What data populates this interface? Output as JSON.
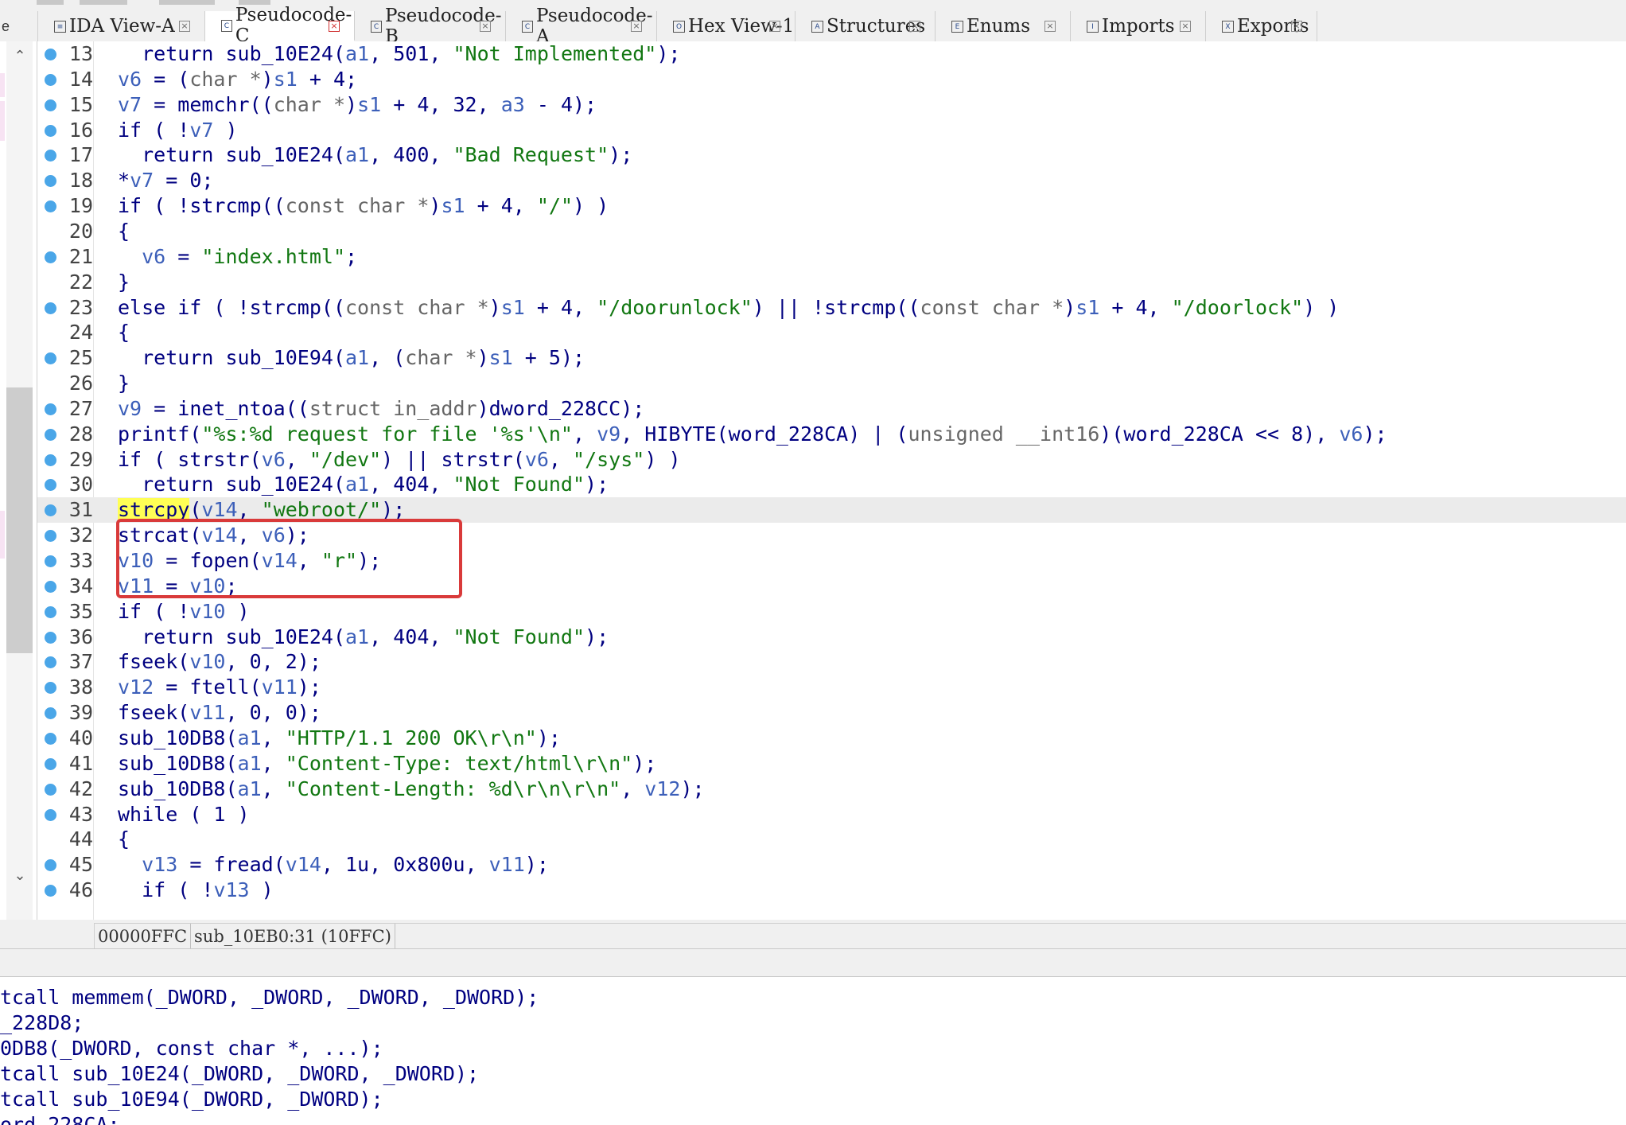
{
  "tabs": [
    {
      "label": "IDA View-A",
      "icon": "ida-view-icon",
      "active": false
    },
    {
      "label": "Pseudocode-C",
      "icon": "pseudocode-icon",
      "active": true
    },
    {
      "label": "Pseudocode-B",
      "icon": "pseudocode-icon",
      "active": false
    },
    {
      "label": "Pseudocode-A",
      "icon": "pseudocode-icon",
      "active": false
    },
    {
      "label": "Hex View-1",
      "icon": "hex-view-icon",
      "active": false
    },
    {
      "label": "Structures",
      "icon": "structures-icon",
      "active": false
    },
    {
      "label": "Enums",
      "icon": "enums-icon",
      "active": false
    },
    {
      "label": "Imports",
      "icon": "imports-icon",
      "active": false
    },
    {
      "label": "Exports",
      "icon": "exports-icon",
      "active": false
    }
  ],
  "tab_stub_label": "e",
  "highlighted_line": 31,
  "boxed_lines": [
    30,
    31,
    32
  ],
  "code_lines": [
    {
      "n": "13",
      "dot": true,
      "tokens": [
        [
          "p",
          "  "
        ],
        [
          "k",
          "return "
        ],
        [
          "g",
          "sub_10E24"
        ],
        [
          "p",
          "("
        ],
        [
          "v",
          "a1"
        ],
        [
          "p",
          ", "
        ],
        [
          "n",
          "501"
        ],
        [
          "p",
          ", "
        ],
        [
          "s",
          "\"Not Implemented\""
        ],
        [
          "p",
          ");"
        ]
      ]
    },
    {
      "n": "14",
      "dot": true,
      "tokens": [
        [
          "v",
          "v6"
        ],
        [
          "p",
          " = ("
        ],
        [
          "c",
          "char *"
        ],
        [
          "p",
          ")"
        ],
        [
          "v",
          "s1"
        ],
        [
          "p",
          " + 4;"
        ]
      ]
    },
    {
      "n": "15",
      "dot": true,
      "tokens": [
        [
          "v",
          "v7"
        ],
        [
          "p",
          " = "
        ],
        [
          "g",
          "memchr"
        ],
        [
          "p",
          "(("
        ],
        [
          "c",
          "char *"
        ],
        [
          "p",
          ")"
        ],
        [
          "v",
          "s1"
        ],
        [
          "p",
          " + 4, 32, "
        ],
        [
          "v",
          "a3"
        ],
        [
          "p",
          " - 4);"
        ]
      ]
    },
    {
      "n": "16",
      "dot": true,
      "tokens": [
        [
          "k",
          "if"
        ],
        [
          "p",
          " ( !"
        ],
        [
          "v",
          "v7"
        ],
        [
          "p",
          " )"
        ]
      ]
    },
    {
      "n": "17",
      "dot": true,
      "tokens": [
        [
          "p",
          "  "
        ],
        [
          "k",
          "return "
        ],
        [
          "g",
          "sub_10E24"
        ],
        [
          "p",
          "("
        ],
        [
          "v",
          "a1"
        ],
        [
          "p",
          ", 400, "
        ],
        [
          "s",
          "\"Bad Request\""
        ],
        [
          "p",
          ");"
        ]
      ]
    },
    {
      "n": "18",
      "dot": true,
      "tokens": [
        [
          "p",
          "*"
        ],
        [
          "v",
          "v7"
        ],
        [
          "p",
          " = 0;"
        ]
      ]
    },
    {
      "n": "19",
      "dot": true,
      "tokens": [
        [
          "k",
          "if"
        ],
        [
          "p",
          " ( !"
        ],
        [
          "g",
          "strcmp"
        ],
        [
          "p",
          "(("
        ],
        [
          "c",
          "const char *"
        ],
        [
          "p",
          ")"
        ],
        [
          "v",
          "s1"
        ],
        [
          "p",
          " + 4, "
        ],
        [
          "s",
          "\"/\""
        ],
        [
          "p",
          ") )"
        ]
      ]
    },
    {
      "n": "20",
      "dot": false,
      "tokens": [
        [
          "p",
          "{"
        ]
      ]
    },
    {
      "n": "21",
      "dot": true,
      "tokens": [
        [
          "p",
          "  "
        ],
        [
          "v",
          "v6"
        ],
        [
          "p",
          " = "
        ],
        [
          "s",
          "\"index.html\""
        ],
        [
          "p",
          ";"
        ]
      ]
    },
    {
      "n": "22",
      "dot": false,
      "tokens": [
        [
          "p",
          "}"
        ]
      ]
    },
    {
      "n": "23",
      "dot": true,
      "tokens": [
        [
          "k",
          "else if"
        ],
        [
          "p",
          " ( !"
        ],
        [
          "g",
          "strcmp"
        ],
        [
          "p",
          "(("
        ],
        [
          "c",
          "const char *"
        ],
        [
          "p",
          ")"
        ],
        [
          "v",
          "s1"
        ],
        [
          "p",
          " + 4, "
        ],
        [
          "s",
          "\"/doorunlock\""
        ],
        [
          "p",
          ") || !"
        ],
        [
          "g",
          "strcmp"
        ],
        [
          "p",
          "(("
        ],
        [
          "c",
          "const char *"
        ],
        [
          "p",
          ")"
        ],
        [
          "v",
          "s1"
        ],
        [
          "p",
          " + 4, "
        ],
        [
          "s",
          "\"/doorlock\""
        ],
        [
          "p",
          ") )"
        ]
      ]
    },
    {
      "n": "24",
      "dot": false,
      "tokens": [
        [
          "p",
          "{"
        ]
      ]
    },
    {
      "n": "25",
      "dot": true,
      "tokens": [
        [
          "p",
          "  "
        ],
        [
          "k",
          "return "
        ],
        [
          "g",
          "sub_10E94"
        ],
        [
          "p",
          "("
        ],
        [
          "v",
          "a1"
        ],
        [
          "p",
          ", ("
        ],
        [
          "c",
          "char *"
        ],
        [
          "p",
          ")"
        ],
        [
          "v",
          "s1"
        ],
        [
          "p",
          " + 5);"
        ]
      ]
    },
    {
      "n": "26",
      "dot": false,
      "tokens": [
        [
          "p",
          "}"
        ]
      ]
    },
    {
      "n": "27",
      "dot": true,
      "tokens": [
        [
          "v",
          "v9"
        ],
        [
          "p",
          " = "
        ],
        [
          "g",
          "inet_ntoa"
        ],
        [
          "p",
          "(("
        ],
        [
          "c",
          "struct in_addr"
        ],
        [
          "p",
          ")"
        ],
        [
          "g",
          "dword_228CC"
        ],
        [
          "p",
          ");"
        ]
      ]
    },
    {
      "n": "28",
      "dot": true,
      "tokens": [
        [
          "g",
          "printf"
        ],
        [
          "p",
          "("
        ],
        [
          "s",
          "\"%s:%d request for file '%s'\\n\""
        ],
        [
          "p",
          ", "
        ],
        [
          "v",
          "v9"
        ],
        [
          "p",
          ", "
        ],
        [
          "g",
          "HIBYTE"
        ],
        [
          "p",
          "("
        ],
        [
          "g",
          "word_228CA"
        ],
        [
          "p",
          ") | ("
        ],
        [
          "c",
          "unsigned __int16"
        ],
        [
          "p",
          ")("
        ],
        [
          "g",
          "word_228CA"
        ],
        [
          "p",
          " << 8), "
        ],
        [
          "v",
          "v6"
        ],
        [
          "p",
          ");"
        ]
      ]
    },
    {
      "n": "29",
      "dot": true,
      "tokens": [
        [
          "k",
          "if"
        ],
        [
          "p",
          " ( "
        ],
        [
          "g",
          "strstr"
        ],
        [
          "p",
          "("
        ],
        [
          "v",
          "v6"
        ],
        [
          "p",
          ", "
        ],
        [
          "s",
          "\"/dev\""
        ],
        [
          "p",
          ") || "
        ],
        [
          "g",
          "strstr"
        ],
        [
          "p",
          "("
        ],
        [
          "v",
          "v6"
        ],
        [
          "p",
          ", "
        ],
        [
          "s",
          "\"/sys\""
        ],
        [
          "p",
          ") )"
        ]
      ]
    },
    {
      "n": "30",
      "dot": true,
      "tokens": [
        [
          "p",
          "  "
        ],
        [
          "k",
          "return "
        ],
        [
          "g",
          "sub_10E24"
        ],
        [
          "p",
          "("
        ],
        [
          "v",
          "a1"
        ],
        [
          "p",
          ", 404, "
        ],
        [
          "s",
          "\"Not Found\""
        ],
        [
          "p",
          ");"
        ]
      ]
    },
    {
      "n": "31",
      "dot": true,
      "tokens": [
        [
          "y",
          "strcpy"
        ],
        [
          "p",
          "("
        ],
        [
          "v",
          "v14"
        ],
        [
          "p",
          ", "
        ],
        [
          "s",
          "\"webroot/\""
        ],
        [
          "p",
          ");"
        ]
      ]
    },
    {
      "n": "32",
      "dot": true,
      "tokens": [
        [
          "g",
          "strcat"
        ],
        [
          "p",
          "("
        ],
        [
          "v",
          "v14"
        ],
        [
          "p",
          ", "
        ],
        [
          "v",
          "v6"
        ],
        [
          "p",
          ");"
        ]
      ]
    },
    {
      "n": "33",
      "dot": true,
      "tokens": [
        [
          "v",
          "v10"
        ],
        [
          "p",
          " = "
        ],
        [
          "g",
          "fopen"
        ],
        [
          "p",
          "("
        ],
        [
          "v",
          "v14"
        ],
        [
          "p",
          ", "
        ],
        [
          "s",
          "\"r\""
        ],
        [
          "p",
          ");"
        ]
      ]
    },
    {
      "n": "34",
      "dot": true,
      "tokens": [
        [
          "v",
          "v11"
        ],
        [
          "p",
          " = "
        ],
        [
          "v",
          "v10"
        ],
        [
          "p",
          ";"
        ]
      ]
    },
    {
      "n": "35",
      "dot": true,
      "tokens": [
        [
          "k",
          "if"
        ],
        [
          "p",
          " ( !"
        ],
        [
          "v",
          "v10"
        ],
        [
          "p",
          " )"
        ]
      ]
    },
    {
      "n": "36",
      "dot": true,
      "tokens": [
        [
          "p",
          "  "
        ],
        [
          "k",
          "return "
        ],
        [
          "g",
          "sub_10E24"
        ],
        [
          "p",
          "("
        ],
        [
          "v",
          "a1"
        ],
        [
          "p",
          ", 404, "
        ],
        [
          "s",
          "\"Not Found\""
        ],
        [
          "p",
          ");"
        ]
      ]
    },
    {
      "n": "37",
      "dot": true,
      "tokens": [
        [
          "g",
          "fseek"
        ],
        [
          "p",
          "("
        ],
        [
          "v",
          "v10"
        ],
        [
          "p",
          ", 0, 2);"
        ]
      ]
    },
    {
      "n": "38",
      "dot": true,
      "tokens": [
        [
          "v",
          "v12"
        ],
        [
          "p",
          " = "
        ],
        [
          "g",
          "ftell"
        ],
        [
          "p",
          "("
        ],
        [
          "v",
          "v11"
        ],
        [
          "p",
          ");"
        ]
      ]
    },
    {
      "n": "39",
      "dot": true,
      "tokens": [
        [
          "g",
          "fseek"
        ],
        [
          "p",
          "("
        ],
        [
          "v",
          "v11"
        ],
        [
          "p",
          ", 0, 0);"
        ]
      ]
    },
    {
      "n": "40",
      "dot": true,
      "tokens": [
        [
          "g",
          "sub_10DB8"
        ],
        [
          "p",
          "("
        ],
        [
          "v",
          "a1"
        ],
        [
          "p",
          ", "
        ],
        [
          "s",
          "\"HTTP/1.1 200 OK\\r\\n\""
        ],
        [
          "p",
          ");"
        ]
      ]
    },
    {
      "n": "41",
      "dot": true,
      "tokens": [
        [
          "g",
          "sub_10DB8"
        ],
        [
          "p",
          "("
        ],
        [
          "v",
          "a1"
        ],
        [
          "p",
          ", "
        ],
        [
          "s",
          "\"Content-Type: text/html\\r\\n\""
        ],
        [
          "p",
          ");"
        ]
      ]
    },
    {
      "n": "42",
      "dot": true,
      "tokens": [
        [
          "g",
          "sub_10DB8"
        ],
        [
          "p",
          "("
        ],
        [
          "v",
          "a1"
        ],
        [
          "p",
          ", "
        ],
        [
          "s",
          "\"Content-Length: %d\\r\\n\\r\\n\""
        ],
        [
          "p",
          ", "
        ],
        [
          "v",
          "v12"
        ],
        [
          "p",
          ");"
        ]
      ]
    },
    {
      "n": "43",
      "dot": true,
      "tokens": [
        [
          "k",
          "while"
        ],
        [
          "p",
          " ( 1 )"
        ]
      ]
    },
    {
      "n": "44",
      "dot": false,
      "tokens": [
        [
          "p",
          "{"
        ]
      ]
    },
    {
      "n": "45",
      "dot": true,
      "tokens": [
        [
          "p",
          "  "
        ],
        [
          "v",
          "v13"
        ],
        [
          "p",
          " = "
        ],
        [
          "g",
          "fread"
        ],
        [
          "p",
          "("
        ],
        [
          "v",
          "v14"
        ],
        [
          "p",
          ", 1u, 0x800u, "
        ],
        [
          "v",
          "v11"
        ],
        [
          "p",
          ");"
        ]
      ]
    },
    {
      "n": "46",
      "dot": true,
      "tokens": [
        [
          "p",
          "  "
        ],
        [
          "k",
          "if"
        ],
        [
          "p",
          " ( !"
        ],
        [
          "v",
          "v13"
        ],
        [
          "p",
          " )"
        ]
      ]
    }
  ],
  "status": {
    "address": "00000FFC",
    "location": "sub_10EB0:31 (10FFC)"
  },
  "bottom_lines": [
    "tcall memmem(_DWORD, _DWORD, _DWORD, _DWORD);",
    "_228D8;",
    "0DB8(_DWORD, const char *, ...);",
    "tcall sub_10E24(_DWORD, _DWORD, _DWORD);",
    "tcall sub_10E94(_DWORD, _DWORD);",
    "ord_228CA;"
  ],
  "colors": {
    "accent_breakpoint": "#4aa6e8",
    "highlight_line": "#ebebeb",
    "search_highlight": "#ffff55",
    "annotation_box": "#d93a3a",
    "string_literal": "#117711",
    "variable": "#3c5fb9"
  }
}
